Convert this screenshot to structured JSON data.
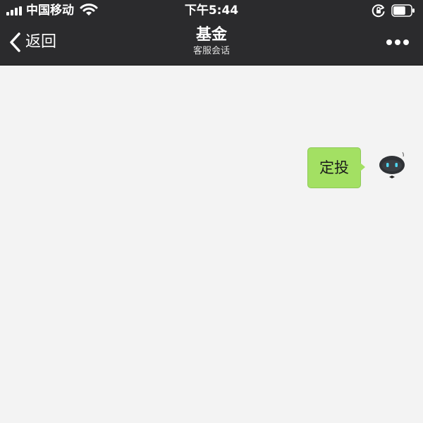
{
  "status_bar": {
    "carrier": "中国移动",
    "time": "下午5:44",
    "icons": [
      "signal-icon",
      "wifi-icon",
      "rotation-lock-icon",
      "battery-icon"
    ],
    "battery_level": 0.7
  },
  "nav": {
    "back_label": "返回",
    "title": "基金",
    "subtitle": "客服会话",
    "icons": [
      "chevron-left-icon",
      "more-icon"
    ]
  },
  "chat": {
    "messages": [
      {
        "sender": "user",
        "text": "定投"
      }
    ],
    "bubble_color": "#a3e063",
    "background_color": "#f3f3f3"
  },
  "colors": {
    "bar_background": "#2b2b2d",
    "bar_text": "#ffffff"
  }
}
